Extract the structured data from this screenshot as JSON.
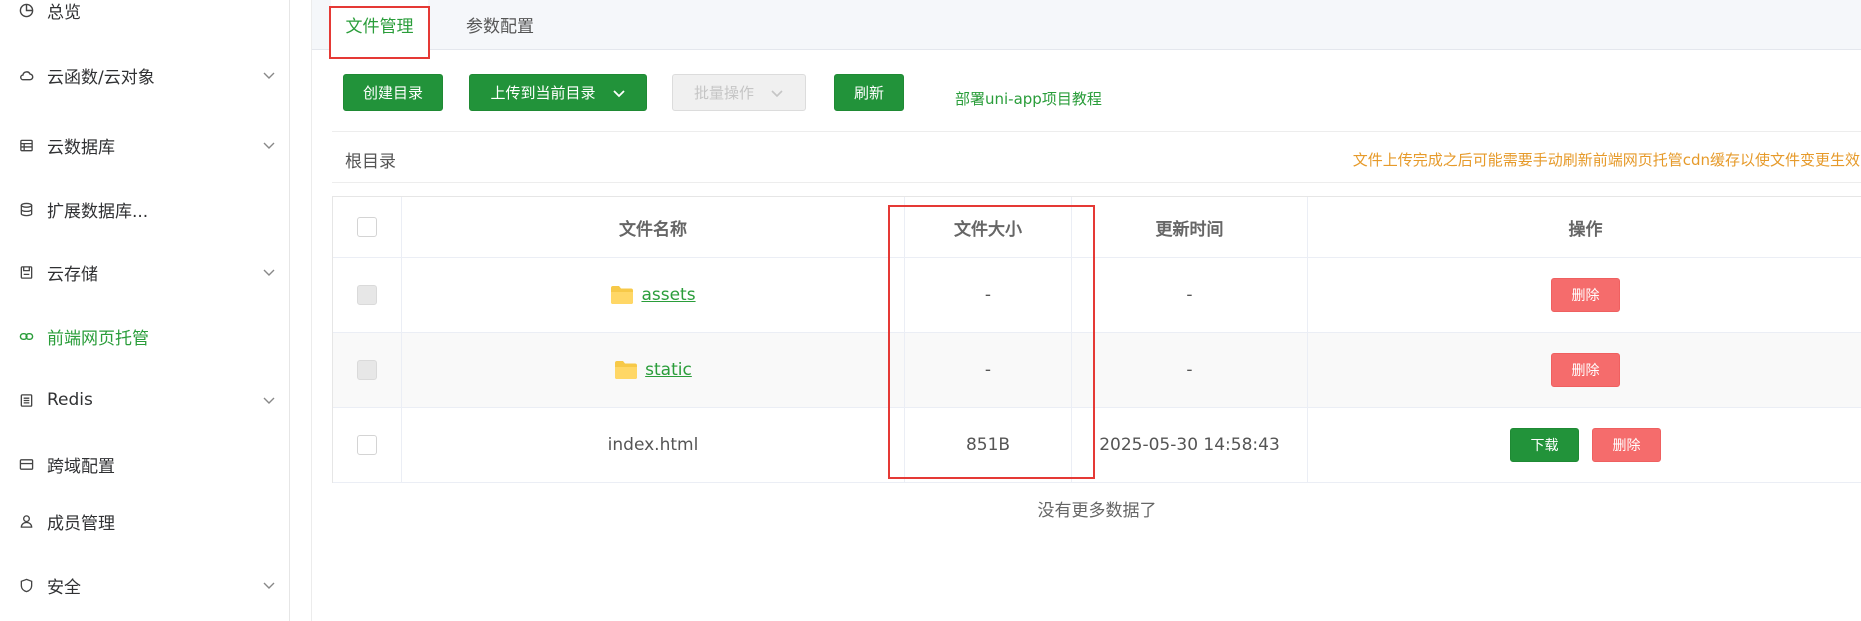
{
  "sidebar": {
    "items": [
      {
        "label": "总览",
        "icon": "dashboard-icon",
        "has_chevron": false
      },
      {
        "label": "云函数/云对象",
        "icon": "cloud-icon",
        "has_chevron": true
      },
      {
        "label": "云数据库",
        "icon": "database-table-icon",
        "has_chevron": true
      },
      {
        "label": "扩展数据库...",
        "icon": "database-stack-icon",
        "has_chevron": false
      },
      {
        "label": "云存储",
        "icon": "storage-icon",
        "has_chevron": true
      },
      {
        "label": "前端网页托管",
        "icon": "web-hosting-icon",
        "has_chevron": false,
        "active": true
      },
      {
        "label": "Redis",
        "icon": "redis-icon",
        "has_chevron": true
      },
      {
        "label": "跨域配置",
        "icon": "cors-icon",
        "has_chevron": false
      },
      {
        "label": "成员管理",
        "icon": "member-icon",
        "has_chevron": false
      },
      {
        "label": "安全",
        "icon": "shield-icon",
        "has_chevron": true
      }
    ]
  },
  "tabs": [
    {
      "label": "文件管理",
      "active": true
    },
    {
      "label": "参数配置",
      "active": false
    }
  ],
  "toolbar": {
    "create_label": "创建目录",
    "upload_label": "上传到当前目录",
    "batch_label": "批量操作",
    "refresh_label": "刷新",
    "tutorial_label": "部署uni-app项目教程"
  },
  "pathbar": {
    "root_label": "根目录",
    "tip": "文件上传完成之后可能需要手动刷新前端网页托管cdn缓存以使文件变更生效"
  },
  "table": {
    "headers": {
      "name": "文件名称",
      "size": "文件大小",
      "time": "更新时间",
      "ops": "操作"
    },
    "rows": [
      {
        "type": "folder",
        "name": "assets",
        "size": "-",
        "time": "-",
        "ops": [
          "删除"
        ]
      },
      {
        "type": "folder",
        "name": "static",
        "size": "-",
        "time": "-",
        "ops": [
          "删除"
        ]
      },
      {
        "type": "file",
        "name": "index.html",
        "size": "851B",
        "time": "2025-05-30 14:58:43",
        "ops": [
          "下载",
          "删除"
        ]
      }
    ]
  },
  "footer": {
    "no_more": "没有更多数据了"
  },
  "colors": {
    "accent": "#2a9d3a",
    "primary_button": "#22933a",
    "danger_button": "#f56c6c",
    "tip_text": "#e69a2a",
    "highlight_box": "#e53935"
  }
}
